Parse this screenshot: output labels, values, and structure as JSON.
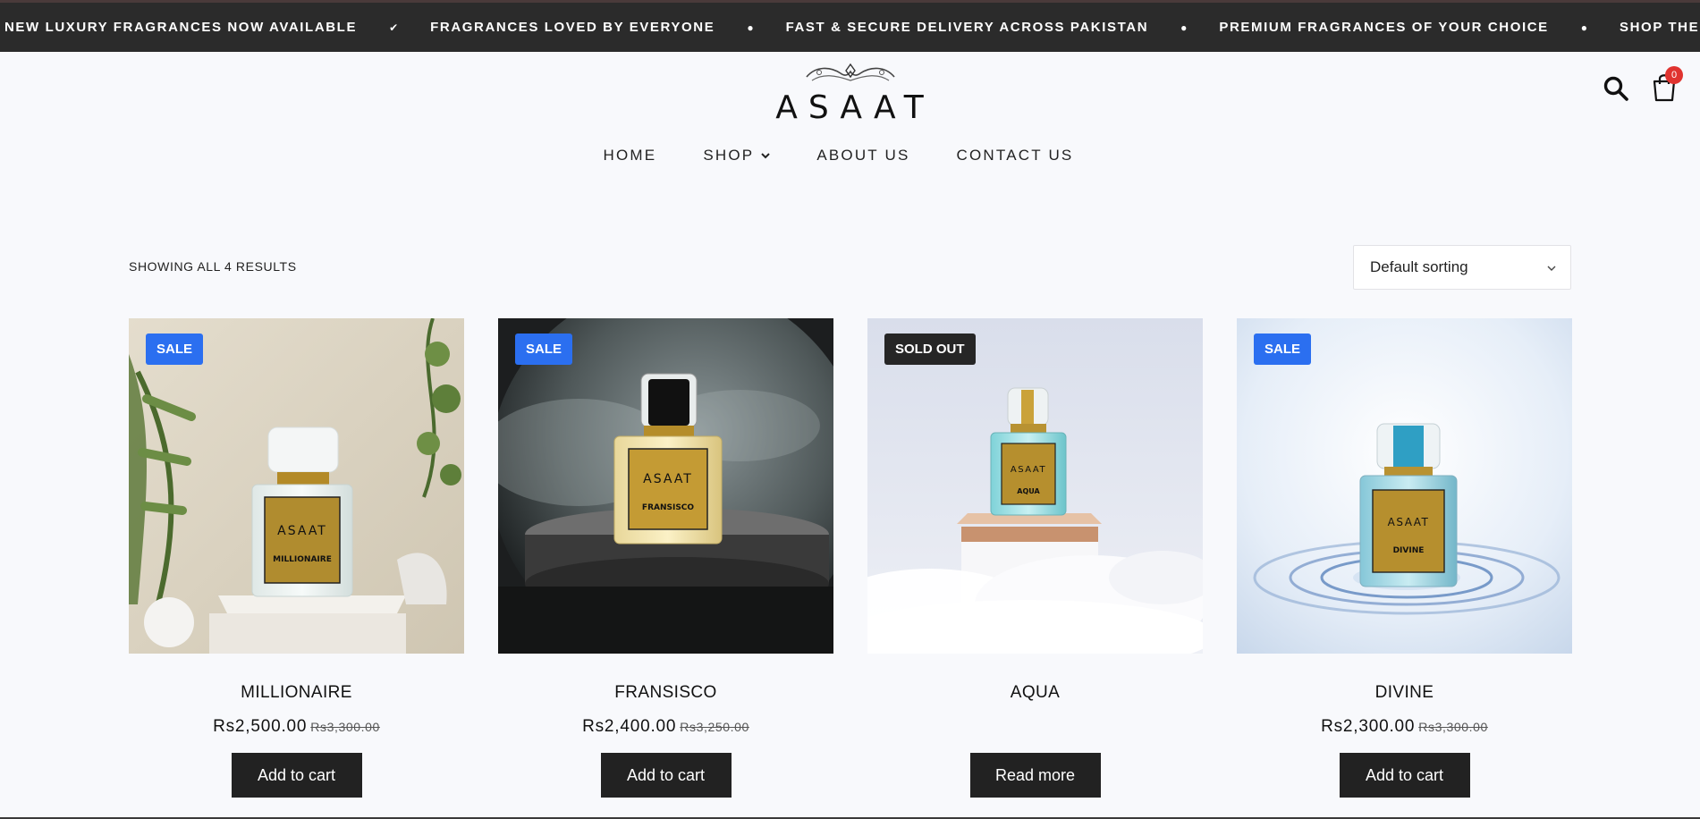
{
  "ticker": {
    "items": [
      "NEW LUXURY FRAGRANCES NOW AVAILABLE",
      "FRAGRANCES LOVED BY EVERYONE",
      "FAST & SECURE DELIVERY ACROSS PAKISTAN",
      "PREMIUM FRAGRANCES OF YOUR CHOICE",
      "SHOP THE LATEST COLLECT"
    ],
    "separators": [
      "✔",
      "●",
      "●",
      "●"
    ]
  },
  "header": {
    "logo_text": "ASAAT",
    "cart_count": "0"
  },
  "nav": {
    "items": [
      {
        "label": "HOME"
      },
      {
        "label": "SHOP"
      },
      {
        "label": "ABOUT US"
      },
      {
        "label": "CONTACT US"
      }
    ]
  },
  "toolbar": {
    "results_text": "SHOWING ALL 4 RESULTS",
    "sort_value": "Default sorting"
  },
  "products": [
    {
      "name": "MILLIONAIRE",
      "badge": "SALE",
      "price": "Rs2,500.00",
      "old_price": "Rs3,300.00",
      "button": "Add to cart",
      "label_name": "MILLIONAIRE"
    },
    {
      "name": "FRANSISCO",
      "badge": "SALE",
      "price": "Rs2,400.00",
      "old_price": "Rs3,250.00",
      "button": "Add to cart",
      "label_name": "FRANSISCO"
    },
    {
      "name": "AQUA",
      "badge": "SOLD OUT",
      "price": "",
      "old_price": "",
      "button": "Read more",
      "label_name": "AQUA"
    },
    {
      "name": "DIVINE",
      "badge": "SALE",
      "price": "Rs2,300.00",
      "old_price": "Rs3,300.00",
      "button": "Add to cart",
      "label_name": "DIVINE"
    }
  ],
  "colors": {
    "sale_badge": "#2b6ff0",
    "sold_badge": "#262626",
    "button_bg": "#222222",
    "cart_badge": "#e0332f"
  }
}
